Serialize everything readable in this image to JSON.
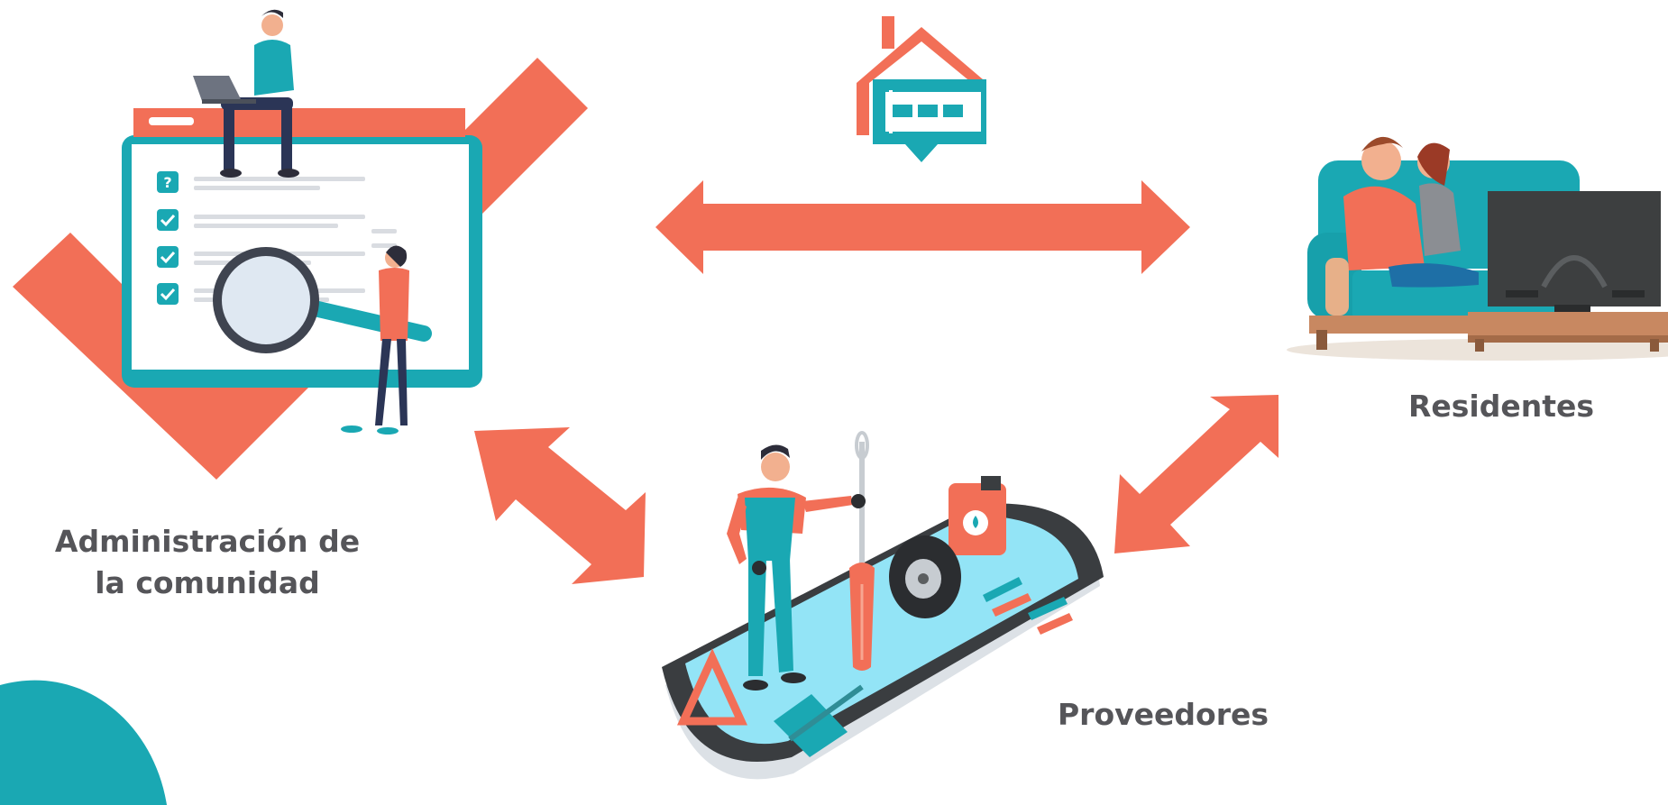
{
  "nodes": {
    "administracion": {
      "label_line1": "Administración de",
      "label_line2": "la comunidad"
    },
    "residentes": {
      "label": "Residentes"
    },
    "proveedores": {
      "label": "Proveedores"
    }
  },
  "colors": {
    "coral": "#f26f57",
    "teal": "#1aa8b3",
    "label_text": "#555559",
    "phone_screen": "#93e4f6",
    "tv": "#3d3f40"
  },
  "icons": [
    "house-chat-logo-icon",
    "checklist-icon",
    "magnifier-icon",
    "screwdriver-icon",
    "tire-icon",
    "oil-can-icon",
    "pliers-icon",
    "warning-triangle-icon",
    "car-jack-icon",
    "tv-icon",
    "sofa-icon"
  ]
}
